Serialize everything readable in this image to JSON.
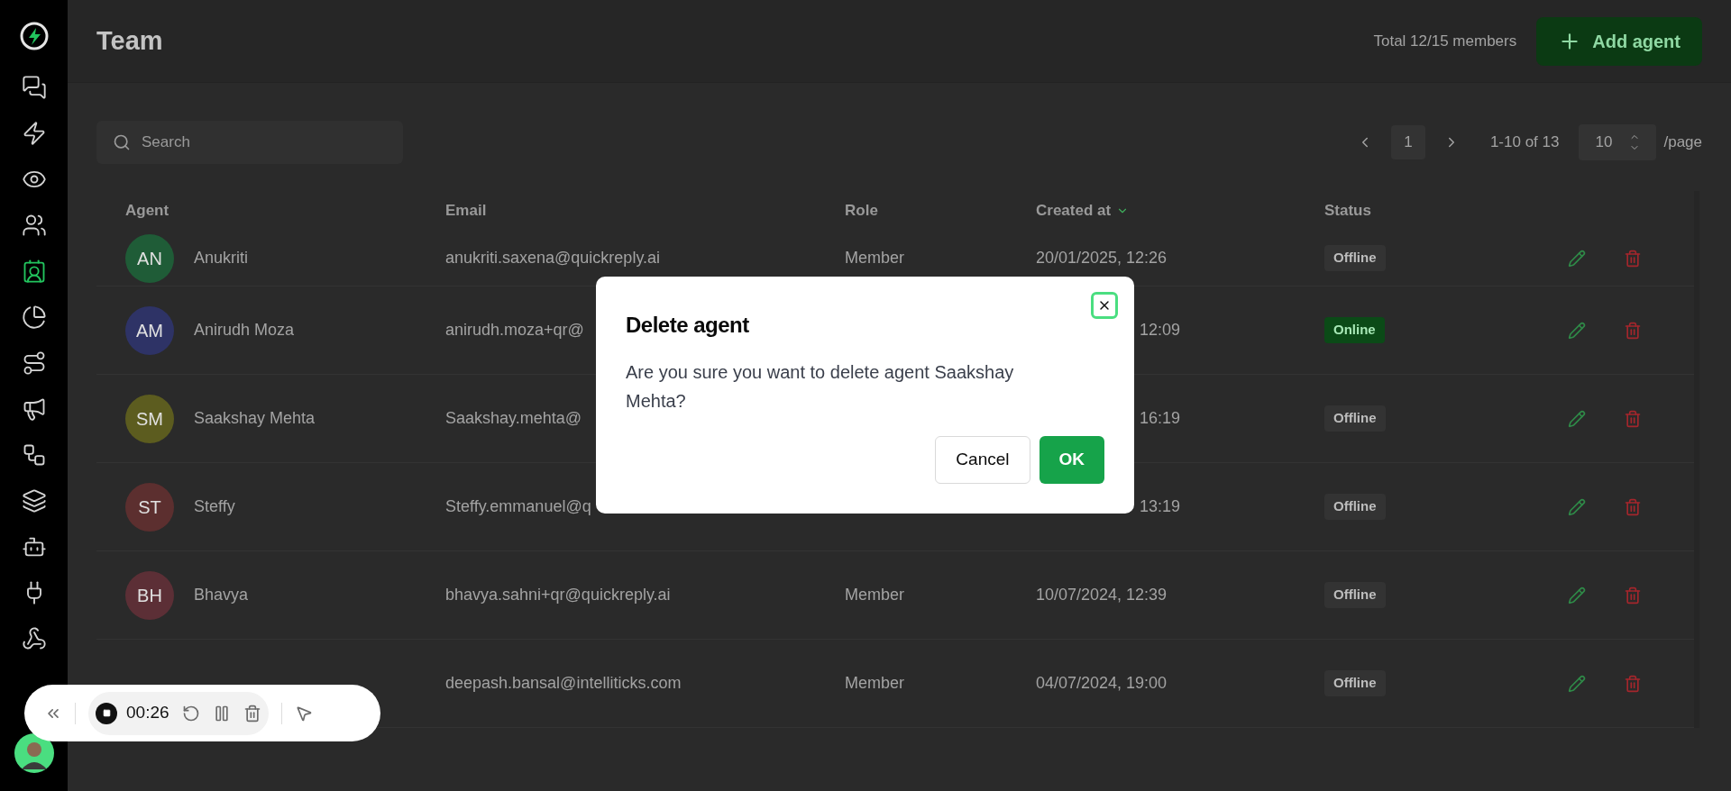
{
  "sidebar": {
    "items": [
      {
        "selected": false
      },
      {
        "selected": false
      },
      {
        "selected": false
      },
      {
        "selected": false
      },
      {
        "selected": true
      },
      {
        "selected": false
      },
      {
        "selected": false
      },
      {
        "selected": false
      },
      {
        "selected": false
      },
      {
        "selected": false
      },
      {
        "selected": false
      },
      {
        "selected": false
      },
      {
        "selected": false
      }
    ]
  },
  "header": {
    "title": "Team",
    "total": "Total 12/15 members",
    "add_button": "Add agent"
  },
  "search": {
    "placeholder": "Search"
  },
  "pagination": {
    "page": "1",
    "range": "1-10 of 13",
    "page_size": "10",
    "per_page": "/page"
  },
  "table": {
    "columns": [
      "Agent",
      "Email",
      "Role",
      "Created at",
      "Status"
    ],
    "rows": [
      {
        "initials": "AN",
        "color": "#1f5c37",
        "name": "Anukriti",
        "email": "anukriti.saxena@quickreply.ai",
        "role": "Member",
        "created": "20/01/2025, 12:26",
        "status": "Offline",
        "online": false
      },
      {
        "initials": "AM",
        "color": "#2e3366",
        "name": "Anirudh Moza",
        "email": "anirudh.moza+qr@",
        "created": "12:09",
        "status": "Online",
        "online": true
      },
      {
        "initials": "SM",
        "color": "#5c5c1f",
        "name": "Saakshay Mehta",
        "email": "Saakshay.mehta@",
        "created": "16:19",
        "status": "Offline",
        "online": false
      },
      {
        "initials": "ST",
        "color": "#5c2f2f",
        "name": "Steffy",
        "email": "Steffy.emmanuel@q",
        "created": "13:19",
        "status": "Offline",
        "online": false
      },
      {
        "initials": "BH",
        "color": "#5c2f36",
        "name": "Bhavya",
        "email": "bhavya.sahni+qr@quickreply.ai",
        "role": "Member",
        "created": "10/07/2024, 12:39",
        "status": "Offline",
        "online": false
      },
      {
        "email": "deepash.bansal@intelliticks.com",
        "role": "Member",
        "created": "04/07/2024, 19:00",
        "status": "Offline",
        "online": false
      }
    ]
  },
  "dialog": {
    "title": "Delete agent",
    "message": "Are you sure you want to delete agent Saakshay Mehta?",
    "buttons": [
      "Cancel",
      "OK"
    ]
  },
  "recorder": {
    "time": "00:26"
  }
}
